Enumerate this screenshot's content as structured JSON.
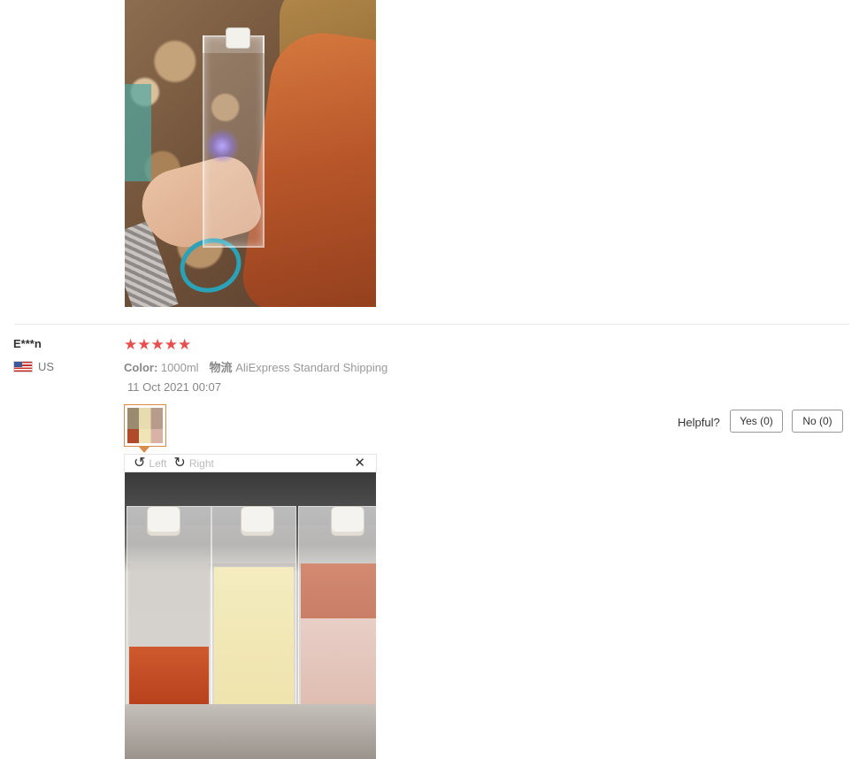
{
  "previous_review": {
    "photo_alt": "Clear bottle held in hand photo"
  },
  "review": {
    "user_name": "E***n",
    "country": "US",
    "stars": "★★★★★",
    "color_label": "Color:",
    "color_value": "1000ml",
    "shipping_label": "物流",
    "shipping_value": "AliExpress Standard Shipping",
    "date": "11 Oct 2021 00:07",
    "helpful_label": "Helpful?",
    "yes_label": "Yes (0)",
    "no_label": "No (0)"
  },
  "viewer": {
    "rotate_left_icon": "↺",
    "rotate_left_label": "Left",
    "rotate_right_icon": "↻",
    "rotate_right_label": "Right",
    "close_icon": "✕"
  },
  "colors": {
    "star": "#e84e4e",
    "thumb_border": "#d98c4a"
  }
}
